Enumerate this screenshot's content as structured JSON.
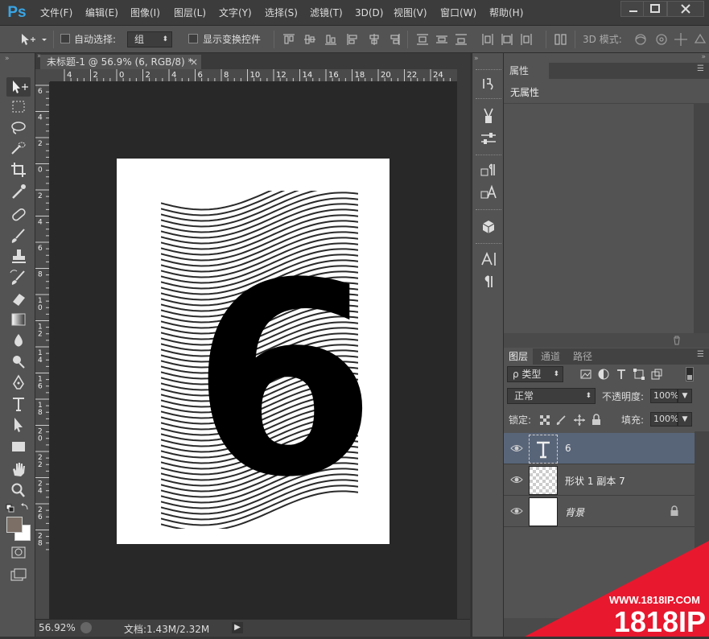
{
  "app": {
    "logo": "Ps"
  },
  "menu": [
    {
      "label": "文件(F)"
    },
    {
      "label": "编辑(E)"
    },
    {
      "label": "图像(I)"
    },
    {
      "label": "图层(L)"
    },
    {
      "label": "文字(Y)"
    },
    {
      "label": "选择(S)"
    },
    {
      "label": "滤镜(T)"
    },
    {
      "label": "3D(D)"
    },
    {
      "label": "视图(V)"
    },
    {
      "label": "窗口(W)"
    },
    {
      "label": "帮助(H)"
    }
  ],
  "options": {
    "auto_select_label": "自动选择:",
    "auto_select_value": "组",
    "show_transform_label": "显示变换控件",
    "mode3d_label": "3D 模式:"
  },
  "document": {
    "tab_title": "未标题-1 @ 56.9% (6, RGB/8) *",
    "close_glyph": "×",
    "artwork_text": "6"
  },
  "rulers": {
    "horizontal": [
      "4",
      "2",
      "0",
      "2",
      "4",
      "6",
      "8",
      "10",
      "12",
      "14",
      "16",
      "18",
      "20",
      "22",
      "24"
    ],
    "vertical": [
      "6",
      "4",
      "2",
      "0",
      "2",
      "4",
      "6",
      "8",
      "10",
      "12",
      "14",
      "16",
      "18",
      "20",
      "22",
      "24",
      "26",
      "28"
    ]
  },
  "status": {
    "zoom": "56.92%",
    "doc_info": "文档:1.43M/2.32M"
  },
  "properties": {
    "tab_label": "属性",
    "empty_message": "无属性"
  },
  "layers_panel": {
    "tabs": [
      "图层",
      "通道",
      "路径"
    ],
    "filter_label": "ρ 类型",
    "blend_mode": "正常",
    "opacity_label": "不透明度:",
    "opacity_value": "100%",
    "lock_label": "锁定:",
    "fill_label": "填充:",
    "fill_value": "100%",
    "layers": [
      {
        "name": "6",
        "type": "text",
        "selected": true
      },
      {
        "name": "形状 1 副本 7",
        "type": "shape",
        "selected": false
      },
      {
        "name": "背景",
        "type": "background",
        "selected": false,
        "locked": true
      }
    ]
  },
  "watermark": {
    "url": "WWW.1818IP.COM",
    "brand": "1818IP",
    "color": "#e8182e"
  },
  "colors": {
    "foreground": "#7b6f66",
    "background": "#ffffff",
    "selected_layer": "#586579"
  }
}
